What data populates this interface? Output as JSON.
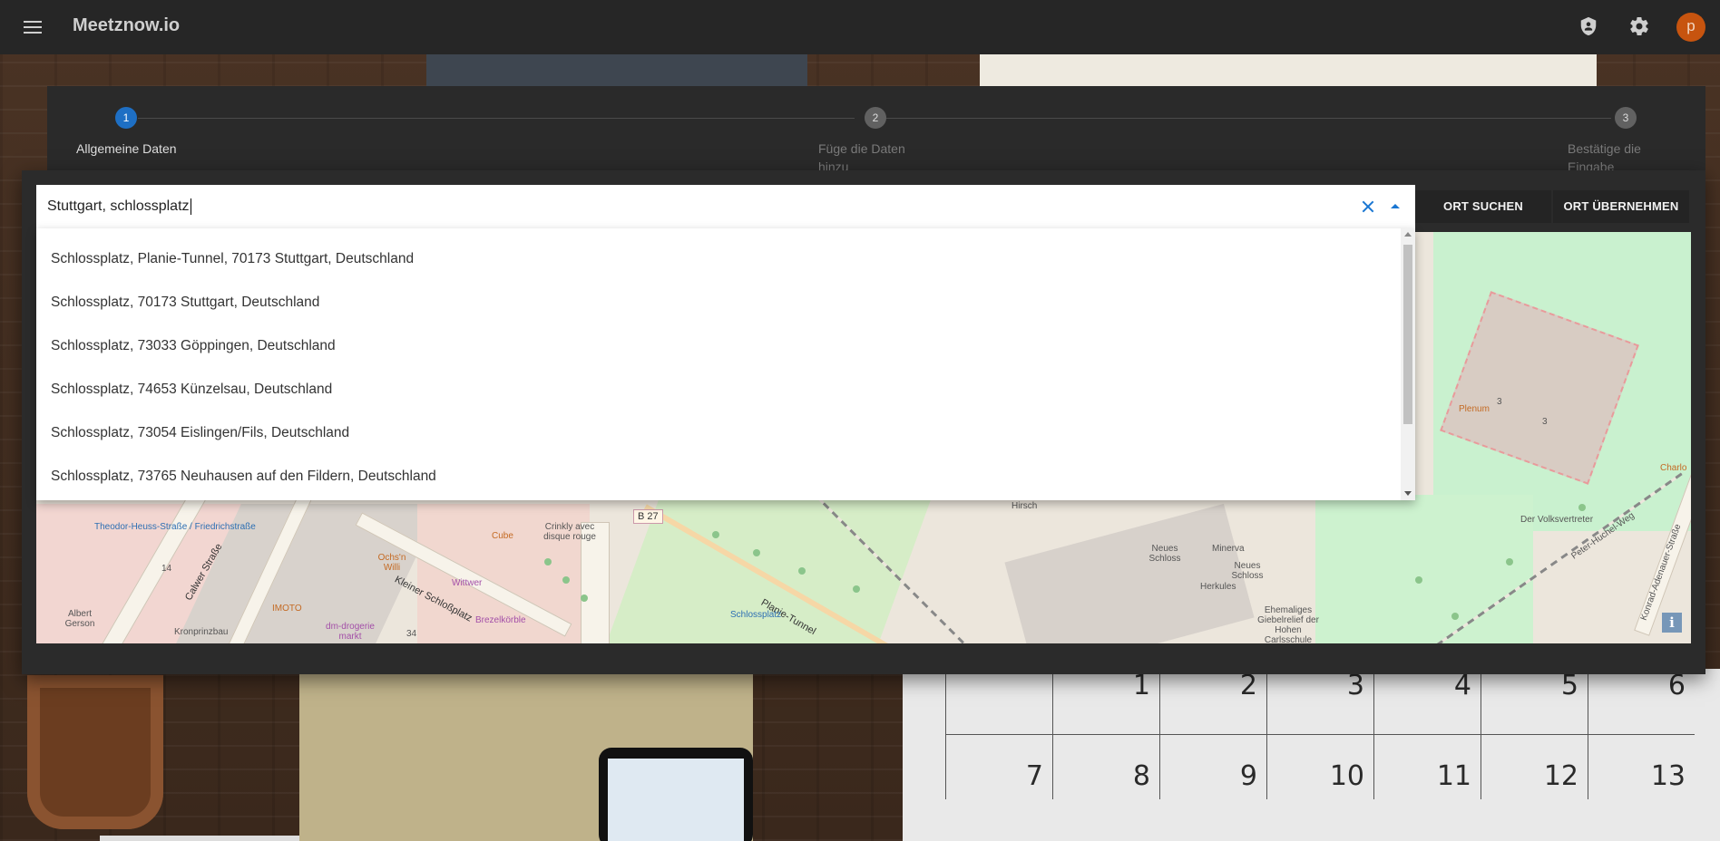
{
  "app": {
    "title": "Meetznow.io",
    "avatar_initial": "p",
    "accent_color": "#1e6fc4",
    "avatar_color": "#c7540f"
  },
  "stepper": {
    "steps": [
      {
        "number": "1",
        "label": "Allgemeine Daten",
        "active": true
      },
      {
        "number": "2",
        "label": "Füge die Daten hinzu",
        "active": false
      },
      {
        "number": "3",
        "label": "Bestätige die Eingabe",
        "active": false
      }
    ]
  },
  "location_search": {
    "value": "Stuttgart, schlossplatz",
    "suggestions": [
      "Schlossplatz, Planie-Tunnel, 70173 Stuttgart, Deutschland",
      "Schlossplatz, 70173 Stuttgart, Deutschland",
      "Schlossplatz, 73033 Göppingen, Deutschland",
      "Schlossplatz, 74653 Künzelsau, Deutschland",
      "Schlossplatz, 73054 Eislingen/Fils, Deutschland",
      "Schlossplatz, 73765 Neuhausen auf den Fildern, Deutschland"
    ],
    "search_button": "ORT SUCHEN",
    "apply_button": "ORT ÜBERNEHMEN"
  },
  "map": {
    "labels": {
      "theodor": "Theodor-Heuss-Straße / Friedrichstraße",
      "calwer": "Calwer Straße",
      "kleiner": "Kleiner Schloßplatz",
      "planie": "Planie-Tunnel",
      "schlossplatz": "Schlossplatz",
      "neues_schloss_poi": "Neues Schloss",
      "neues_schloss": "Neues Schloss",
      "minerva": "Minerva",
      "herkules": "Herkules",
      "plenum": "Plenum",
      "volksvertreter": "Der Volksvertreter",
      "peter": "Peter-Huchel-Weg",
      "konrad": "Konrad-Adenauer-Straße",
      "kronprinzbau": "Kronprinzbau",
      "imoto": "IMOTO",
      "dm": "dm-drogerie markt",
      "wittwer": "Wittwer",
      "ochs": "Ochs'n Willi",
      "cube": "Cube",
      "crinkly": "Crinkly avec disque rouge",
      "brezel": "Brezelkörble",
      "albert": "Albert Gerson",
      "hirsch": "Hirsch",
      "charlo": "Charlo",
      "ehemaliges": "Ehemaliges Giebelrelief der Hohen Carlsschule",
      "b27": "B 27",
      "n14": "14",
      "n34": "34",
      "n3a": "3",
      "n3b": "3",
      "info": "i"
    }
  },
  "calendar": {
    "row1": [
      "",
      "1",
      "2",
      "3",
      "4",
      "5",
      "6"
    ],
    "row2": [
      "7",
      "8",
      "9",
      "10",
      "11",
      "12",
      "13"
    ]
  }
}
